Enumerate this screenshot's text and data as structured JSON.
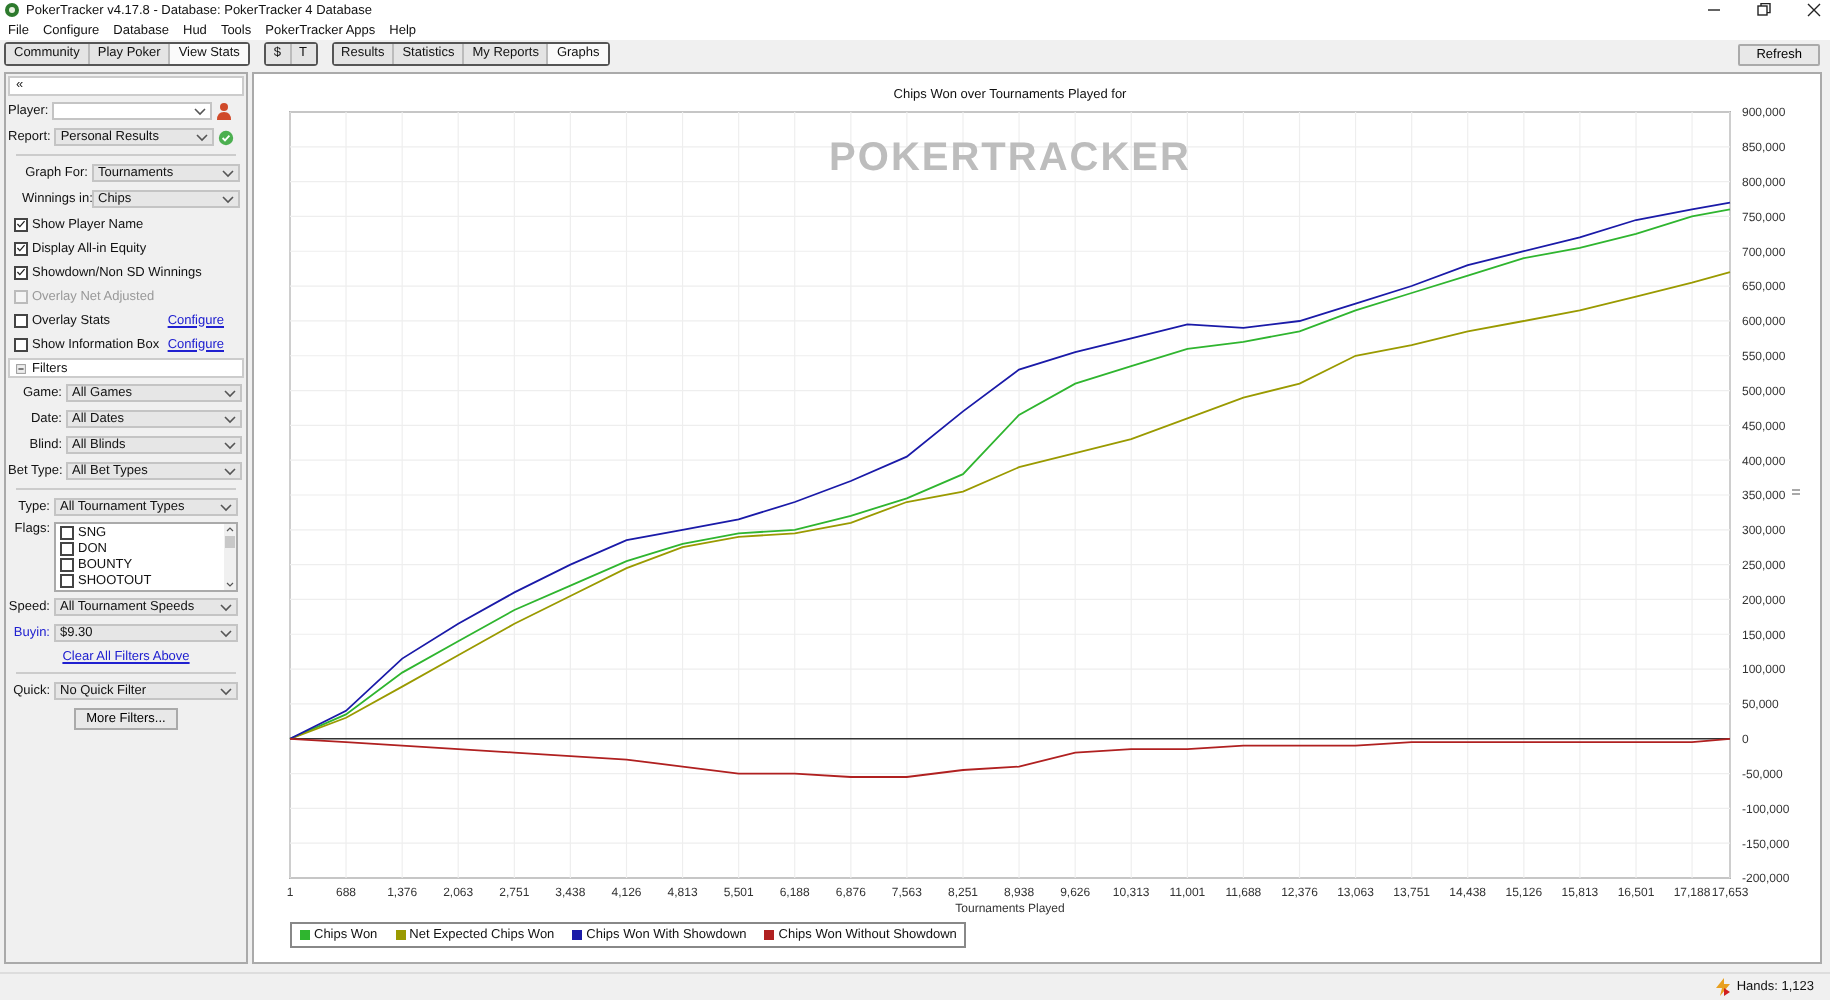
{
  "window": {
    "title": "PokerTracker v4.17.8 - Database: PokerTracker 4 Database"
  },
  "menu": [
    "File",
    "Configure",
    "Database",
    "Hud",
    "Tools",
    "PokerTracker Apps",
    "Help"
  ],
  "toolbar": {
    "groups": [
      [
        {
          "label": "Community",
          "selected": false
        },
        {
          "label": "Play Poker",
          "selected": false
        },
        {
          "label": "View Stats",
          "selected": true
        }
      ],
      [
        {
          "label": "$",
          "selected": false
        },
        {
          "label": "T",
          "selected": false
        }
      ],
      [
        {
          "label": "Results",
          "selected": false
        },
        {
          "label": "Statistics",
          "selected": false
        },
        {
          "label": "My Reports",
          "selected": false
        },
        {
          "label": "Graphs",
          "selected": true
        }
      ]
    ],
    "refresh": "Refresh"
  },
  "left_panel": {
    "collapse": "«",
    "player": {
      "label": "Player:"
    },
    "report": {
      "label": "Report:",
      "value": "Personal Results"
    },
    "graph_settings": [
      {
        "label": "Graph For:",
        "value": "Tournaments"
      },
      {
        "label": "Winnings in:",
        "value": "Chips"
      }
    ],
    "options": [
      {
        "label": "Show Player Name",
        "checked": true,
        "disabled": false
      },
      {
        "label": "Display All-in Equity",
        "checked": true,
        "disabled": false
      },
      {
        "label": "Showdown/Non SD Winnings",
        "checked": true,
        "disabled": false
      },
      {
        "label": "Overlay Net Adjusted",
        "checked": false,
        "disabled": true
      },
      {
        "label": "Overlay Stats",
        "checked": false,
        "disabled": false,
        "link": "Configure"
      },
      {
        "label": "Show Information Box",
        "checked": false,
        "disabled": false,
        "link": "Configure"
      }
    ],
    "filters_header": "Filters",
    "filters": [
      {
        "label": "Game:",
        "value": "All Games"
      },
      {
        "label": "Date:",
        "value": "All Dates"
      },
      {
        "label": "Blind:",
        "value": "All Blinds"
      },
      {
        "label": "Bet Type:",
        "value": "All Bet Types"
      }
    ],
    "type": {
      "label": "Type:",
      "value": "All Tournament Types"
    },
    "flags": {
      "label": "Flags:",
      "items": [
        {
          "label": "SNG",
          "checked": false
        },
        {
          "label": "DON",
          "checked": false
        },
        {
          "label": "BOUNTY",
          "checked": false
        },
        {
          "label": "SHOOTOUT",
          "checked": false
        }
      ]
    },
    "speed": {
      "label": "Speed:",
      "value": "All Tournament Speeds"
    },
    "buyin": {
      "label": "Buyin:",
      "value": "$9.30"
    },
    "clear_link": "Clear All Filters Above",
    "quick": {
      "label": "Quick:",
      "value": "No Quick Filter"
    },
    "more_filters": "More Filters..."
  },
  "chart_panel": {
    "watermark": "POKERTRACKER",
    "chart_data": {
      "type": "line",
      "title": "Chips Won over Tournaments Played for",
      "xlabel": "Tournaments Played",
      "x": [
        1,
        688,
        1376,
        2063,
        2751,
        3438,
        4126,
        4813,
        5501,
        6188,
        6876,
        7563,
        8251,
        8938,
        9626,
        10313,
        11001,
        11688,
        12376,
        13063,
        13751,
        14438,
        15126,
        15813,
        16501,
        17188,
        17653
      ],
      "grid": true,
      "legend": true,
      "xlim": [
        1,
        17653
      ],
      "ylim": [
        -200000,
        900000
      ],
      "xticks": [
        {
          "value": 1,
          "label": "1"
        },
        {
          "value": 688,
          "label": "688"
        },
        {
          "value": 1376,
          "label": "1,376"
        },
        {
          "value": 2063,
          "label": "2,063"
        },
        {
          "value": 2751,
          "label": "2,751"
        },
        {
          "value": 3438,
          "label": "3,438"
        },
        {
          "value": 4126,
          "label": "4,126"
        },
        {
          "value": 4813,
          "label": "4,813"
        },
        {
          "value": 5501,
          "label": "5,501"
        },
        {
          "value": 6188,
          "label": "6,188"
        },
        {
          "value": 6876,
          "label": "6,876"
        },
        {
          "value": 7563,
          "label": "7,563"
        },
        {
          "value": 8251,
          "label": "8,251"
        },
        {
          "value": 8938,
          "label": "8,938"
        },
        {
          "value": 9626,
          "label": "9,626"
        },
        {
          "value": 10313,
          "label": "10,313"
        },
        {
          "value": 11001,
          "label": "11,001"
        },
        {
          "value": 11688,
          "label": "11,688"
        },
        {
          "value": 12376,
          "label": "12,376"
        },
        {
          "value": 13063,
          "label": "13,063"
        },
        {
          "value": 13751,
          "label": "13,751"
        },
        {
          "value": 14438,
          "label": "14,438"
        },
        {
          "value": 15126,
          "label": "15,126"
        },
        {
          "value": 15813,
          "label": "15,813"
        },
        {
          "value": 16501,
          "label": "16,501"
        },
        {
          "value": 17188,
          "label": "17,188"
        },
        {
          "value": 17653,
          "label": "17,653"
        }
      ],
      "yticks": [
        {
          "value": 900000,
          "label": "900,000"
        },
        {
          "value": 850000,
          "label": "850,000"
        },
        {
          "value": 800000,
          "label": "800,000"
        },
        {
          "value": 750000,
          "label": "750,000"
        },
        {
          "value": 700000,
          "label": "700,000"
        },
        {
          "value": 650000,
          "label": "650,000"
        },
        {
          "value": 600000,
          "label": "600,000"
        },
        {
          "value": 550000,
          "label": "550,000"
        },
        {
          "value": 500000,
          "label": "500,000"
        },
        {
          "value": 450000,
          "label": "450,000"
        },
        {
          "value": 400000,
          "label": "400,000"
        },
        {
          "value": 350000,
          "label": "350,000"
        },
        {
          "value": 300000,
          "label": "300,000"
        },
        {
          "value": 250000,
          "label": "250,000"
        },
        {
          "value": 200000,
          "label": "200,000"
        },
        {
          "value": 150000,
          "label": "150,000"
        },
        {
          "value": 100000,
          "label": "100,000"
        },
        {
          "value": 50000,
          "label": "50,000"
        },
        {
          "value": 0,
          "label": "0"
        },
        {
          "value": -50000,
          "label": "-50,000"
        },
        {
          "value": -100000,
          "label": "-100,000"
        },
        {
          "value": -150000,
          "label": "-150,000"
        },
        {
          "value": -200000,
          "label": "-200,000"
        }
      ],
      "series": [
        {
          "name": "Chips Won",
          "color": "#2fb52f",
          "values": [
            0,
            35000,
            95000,
            140000,
            185000,
            220000,
            255000,
            280000,
            295000,
            300000,
            320000,
            345000,
            380000,
            465000,
            510000,
            535000,
            560000,
            570000,
            585000,
            615000,
            640000,
            665000,
            690000,
            705000,
            725000,
            750000,
            760000
          ]
        },
        {
          "name": "Net Expected Chips Won",
          "color": "#9a9a00",
          "values": [
            0,
            30000,
            75000,
            120000,
            165000,
            205000,
            245000,
            275000,
            290000,
            295000,
            310000,
            340000,
            355000,
            390000,
            410000,
            430000,
            460000,
            490000,
            510000,
            550000,
            565000,
            585000,
            600000,
            615000,
            635000,
            655000,
            670000
          ]
        },
        {
          "name": "Chips Won With Showdown",
          "color": "#1a1aa8",
          "values": [
            0,
            40000,
            115000,
            165000,
            210000,
            250000,
            285000,
            300000,
            315000,
            340000,
            370000,
            405000,
            470000,
            530000,
            555000,
            575000,
            595000,
            590000,
            600000,
            625000,
            650000,
            680000,
            700000,
            720000,
            745000,
            760000,
            770000
          ]
        },
        {
          "name": "Chips Won Without Showdown",
          "color": "#b02020",
          "values": [
            0,
            -5000,
            -10000,
            -15000,
            -20000,
            -25000,
            -30000,
            -40000,
            -50000,
            -50000,
            -55000,
            -55000,
            -45000,
            -40000,
            -20000,
            -15000,
            -15000,
            -10000,
            -10000,
            -10000,
            -5000,
            -5000,
            -5000,
            -5000,
            -5000,
            -5000,
            0
          ]
        }
      ]
    }
  },
  "status_bar": {
    "hands": "Hands: 1,123"
  }
}
